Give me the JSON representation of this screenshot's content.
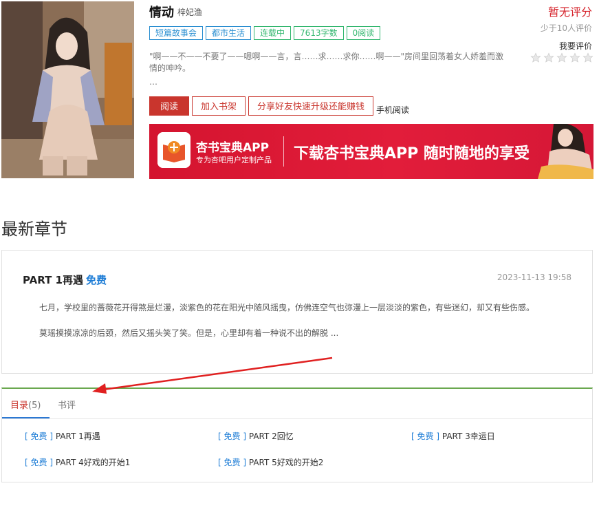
{
  "book": {
    "title": "情动",
    "author": "梓妃渔",
    "tags": [
      "短篇故事会",
      "都市生活",
      "连载中",
      "7613字数",
      "0阅读"
    ],
    "intro": "\"啊——不——不要了——嗯啊——言，言……求……求你……啊——\"房间里回荡着女人娇羞而激情的呻吟。",
    "intro_more": "…"
  },
  "rating": {
    "score_text": "暂无评分",
    "sub_text": "少于10人评价",
    "my_rate": "我要评价",
    "stars": 5
  },
  "actions": {
    "read": "阅读",
    "add_shelf": "加入书架",
    "share": "分享好友快速升级还能赚钱",
    "mobile": "手机阅读"
  },
  "banner": {
    "app_name": "杏书宝典APP",
    "app_sub": "专为杏吧用户定制产品",
    "slogan": "下载杏书宝典APP 随时随地的享受"
  },
  "latest": {
    "heading": "最新章节",
    "chapter_title": "PART 1再遇",
    "free_label": "免费",
    "date": "2023-11-13 19:58",
    "p1": "七月，学校里的蔷薇花开得煞是烂漫，淡紫色的花在阳光中随风摇曳，仿佛连空气也弥漫上一层淡淡的紫色，有些迷幻，却又有些伤感。",
    "p2": "莫瑶摸摸凉凉的后颈，然后又摇头笑了笑。但是，心里却有着一种说不出的解脱 ..."
  },
  "tabs": {
    "toc_label": "目录",
    "toc_count": "(5)",
    "review_label": "书评"
  },
  "toc": [
    {
      "free": "免费",
      "title": "PART 1再遇"
    },
    {
      "free": "免费",
      "title": "PART 2回忆"
    },
    {
      "free": "免费",
      "title": "PART 3幸运日"
    },
    {
      "free": "免费",
      "title": "PART 4好戏的开始1"
    },
    {
      "free": "免费",
      "title": "PART 5好戏的开始2"
    }
  ],
  "colors": {
    "accent_red": "#c9352d",
    "link_blue": "#1e7dd6",
    "tag_green": "#33b76f",
    "tab_green": "#6aa84f"
  }
}
